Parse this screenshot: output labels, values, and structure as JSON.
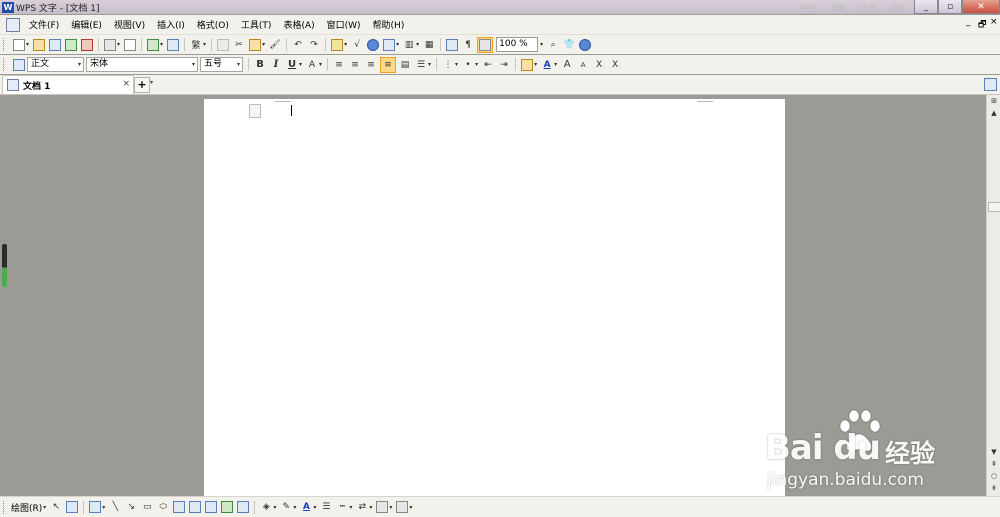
{
  "window": {
    "title": "WPS 文字 - [文档 1]",
    "app_icon_glyph": "W",
    "buttons": [
      "minimize-button",
      "restore-button",
      "close-button"
    ],
    "ghost_texts": [
      "SPH",
      "提醒",
      "天气",
      "记录",
      "…"
    ]
  },
  "menubar": {
    "items": [
      "文件(F)",
      "编辑(E)",
      "视图(V)",
      "插入(I)",
      "格式(O)",
      "工具(T)",
      "表格(A)",
      "窗口(W)",
      "帮助(H)"
    ],
    "mdi_controls": [
      "_",
      "🗗",
      "×"
    ]
  },
  "toolbar_standard": {
    "zoom": "100 %"
  },
  "toolbar_format": {
    "style": "正文",
    "font": "宋体",
    "size": "五号",
    "bold": "B",
    "italic": "I",
    "underline": "U",
    "font_color_letter": "A",
    "grow": "A",
    "shrink": "A",
    "superscript": "X",
    "subscript": "X"
  },
  "tabs": {
    "items": [
      {
        "label": "文档 1"
      }
    ],
    "close_glyph": "×",
    "new_glyph": "+"
  },
  "drawing_toolbar": {
    "label": "绘图(R)"
  },
  "watermark": {
    "logo": "Bai du",
    "cn": "经验",
    "url": "jingyan.baidu.com"
  }
}
